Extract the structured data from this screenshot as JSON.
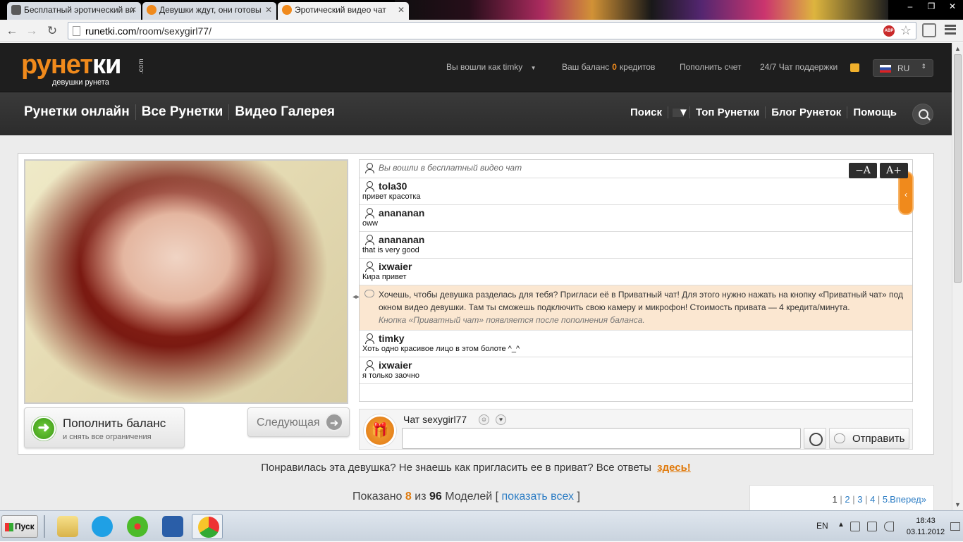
{
  "browser": {
    "tabs": [
      {
        "title": "Бесплатный эротический ви"
      },
      {
        "title": "Девушки ждут, они готовы"
      },
      {
        "title": "Эротический видео чат"
      }
    ],
    "address": {
      "host": "runetki.com",
      "path": "/room/sexygirl77/"
    },
    "window_controls": {
      "minimize": "–",
      "restore": "❐",
      "close": "✕"
    }
  },
  "site": {
    "logo": {
      "part1": "рунет",
      "part2": "ки",
      "suffix": ".com",
      "tagline": "девушки рунета"
    },
    "header": {
      "logged_in": "Вы вошли как timky",
      "balance_label": "Ваш баланс",
      "balance_value": "0",
      "balance_unit": "кредитов",
      "topup_link": "Пополнить счет",
      "support": "24/7 Чат поддержки",
      "language": "RU"
    },
    "nav_left": [
      "Рунетки онлайн",
      "Все Рунетки",
      "Видео Галерея"
    ],
    "nav_right": {
      "search": "Поиск",
      "top": "Топ Рунетки",
      "blog": "Блог Рунеток",
      "help": "Помощь"
    }
  },
  "room": {
    "topup_button": {
      "title": "Пополнить баланс",
      "subtitle": "и снять все ограничения"
    },
    "next_button": "Следующая",
    "font_controls": {
      "decrease": "−A",
      "increase": "A+"
    },
    "chat": {
      "system": "Вы вошли в бесплатный видео чат",
      "messages": [
        {
          "user": "tola30",
          "text": "привет красотка"
        },
        {
          "user": "anananan",
          "text": "oww"
        },
        {
          "user": "anananan",
          "text": "that is very good"
        },
        {
          "user": "ixwaier",
          "text": "Кира привет"
        }
      ],
      "promo": {
        "text": "Хочешь, чтобы девушка разделась для тебя? Пригласи её в Приватный чат!  Для этого нужно нажать на кнопку «Приватный чат» под окном видео девушки. Там ты сможешь подключить свою камеру и микрофон! Стоимость привата — 4 кредита/минута.",
        "note": "Кнопка «Приватный чат» появляется после пополнения баланса."
      },
      "messages_after": [
        {
          "user": "timky",
          "text": "Хоть одно красивое лицо в этом болоте ^_^"
        },
        {
          "user": "ixwaier",
          "text": "я только заочно"
        }
      ]
    },
    "composer": {
      "title": "Чат sexygirl77",
      "input_value": "",
      "send": "Отправить"
    }
  },
  "footer": {
    "question": "Понравилась эта девушка? Не знаешь как пригласить ее в приват? Все ответы",
    "question_link": "здесь!",
    "shown_prefix": "Показано",
    "shown_count": "8",
    "shown_of": "из",
    "shown_total": "96",
    "shown_suffix": "Моделей [",
    "show_all": "показать всех",
    "shown_close": "]",
    "pages": [
      "1",
      "2",
      "3",
      "4",
      "5..."
    ],
    "forward": "Вперед»"
  },
  "taskbar": {
    "start": "Пуск",
    "apps": [
      "folder-icon",
      "skype-icon",
      "icq-icon",
      "word-icon",
      "chrome-icon"
    ],
    "language": "EN",
    "time": "18:43",
    "date": "03.11.2012"
  },
  "colors": {
    "brand_orange": "#f08a1c",
    "header_bg": "#1e1e1e",
    "link_blue": "#2b7cc4",
    "promo_bg": "#fbe7d1"
  }
}
